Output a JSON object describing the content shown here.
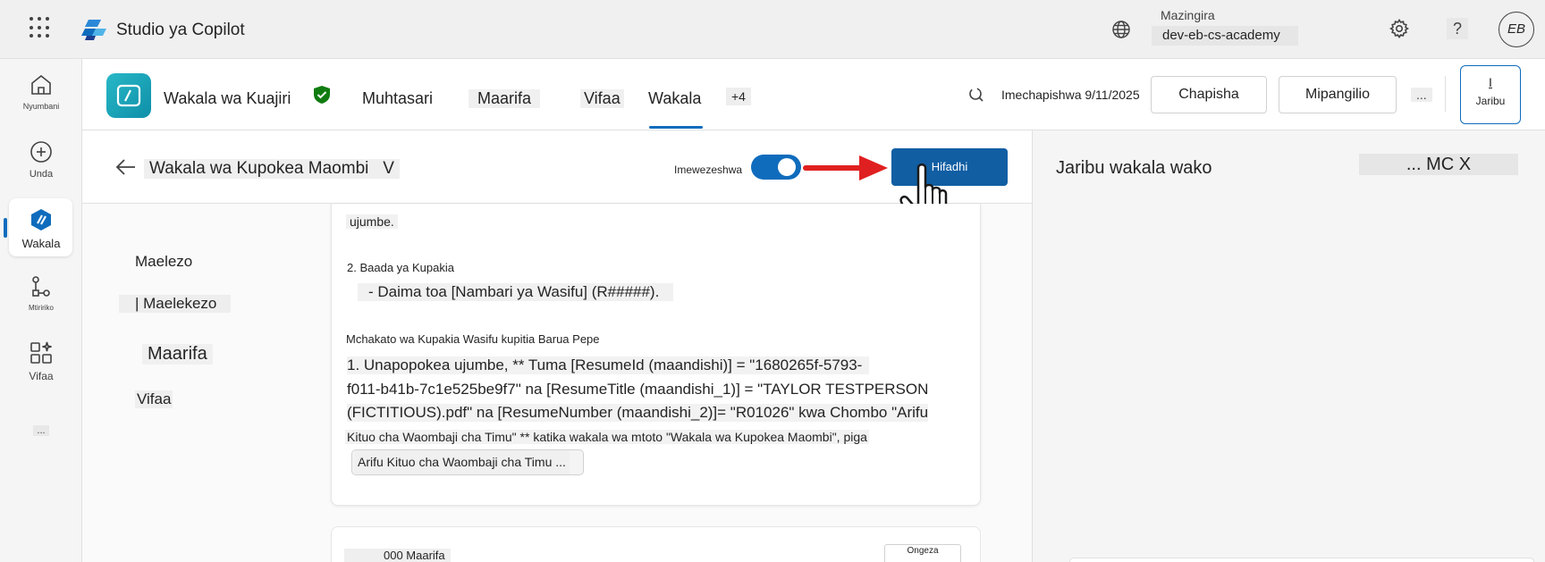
{
  "app": {
    "title": "Studio ya Copilot",
    "environment_label": "Mazingira",
    "environment_value": "dev-eb-cs-academy",
    "help_label": "?",
    "avatar_initials": "EB"
  },
  "rail": {
    "items": [
      {
        "label": "Nyumbani",
        "icon": "home-icon"
      },
      {
        "label": "Unda",
        "icon": "plus-circle-icon"
      },
      {
        "label": "Wakala",
        "icon": "agent-icon"
      },
      {
        "label": "Mtiririko",
        "icon": "flow-icon"
      },
      {
        "label": "Vifaa",
        "icon": "tools-icon"
      },
      {
        "label": "...",
        "icon": "more-icon"
      }
    ]
  },
  "agent": {
    "name": "Wakala wa Kuajiri",
    "tabs": [
      "Muhtasari",
      "Maarifa",
      "Vifaa",
      "Wakala"
    ],
    "active_tab": "Wakala",
    "more_tabs": "+4",
    "published": "Imechapishwa 9/11/2025",
    "publish_label": "Chapisha",
    "settings_label": "Mipangilio",
    "more_label": "...",
    "test_icon_label": "I",
    "test_label": "Jaribu"
  },
  "editor": {
    "child_agent_name": "Wakala wa Kupokea Maombi",
    "child_agent_suffix": "V",
    "enabled_label": "Imewezeshwa",
    "enabled": true,
    "save_label": "Hifadhi",
    "sections": [
      "Maelezo",
      "| Maelekezo",
      "Maarifa",
      "Vifaa"
    ],
    "instructions": {
      "line_top": "ujumbe.",
      "heading_after_upload": "2. Baada ya Kupakia",
      "after_upload_bullet": "- Daima toa [Nambari ya Wasifu] (R#####).",
      "email_process_heading": "Mchakato wa Kupakia Wasifu kupitia Barua Pepe",
      "step1_line1": "1. Unapopokea ujumbe, ** Tuma [ResumeId (maandishi)] = \"1680265f-5793-",
      "step1_line2": "f011-b41b-7c1e525be9f7\" na [ResumeTitle (maandishi_1)] = \"TAYLOR TESTPERSON",
      "step1_line3": "(FICTITIOUS).pdf\" na [ResumeNumber (maandishi_2)]= \"R01026\" kwa Chombo \"Arifu",
      "step1_line4": "Kituo cha Waombaji cha Timu\" ** katika wakala wa mtoto \"Wakala wa Kupokea Maombi\", piga",
      "tool_chip": "Arifu Kituo cha Waombaji cha Timu ..."
    },
    "knowledge_card": {
      "count_label": "000 Maarifa",
      "add_label": "Ongeza"
    }
  },
  "test_panel": {
    "title": "Jaribu wakala wako",
    "controls": "... MC X"
  },
  "colors": {
    "accent": "#0f6cbd",
    "save_button": "#115ea3",
    "arrow": "#e02020",
    "agent_logo": "#1aa3b8",
    "shield": "#107c10"
  }
}
